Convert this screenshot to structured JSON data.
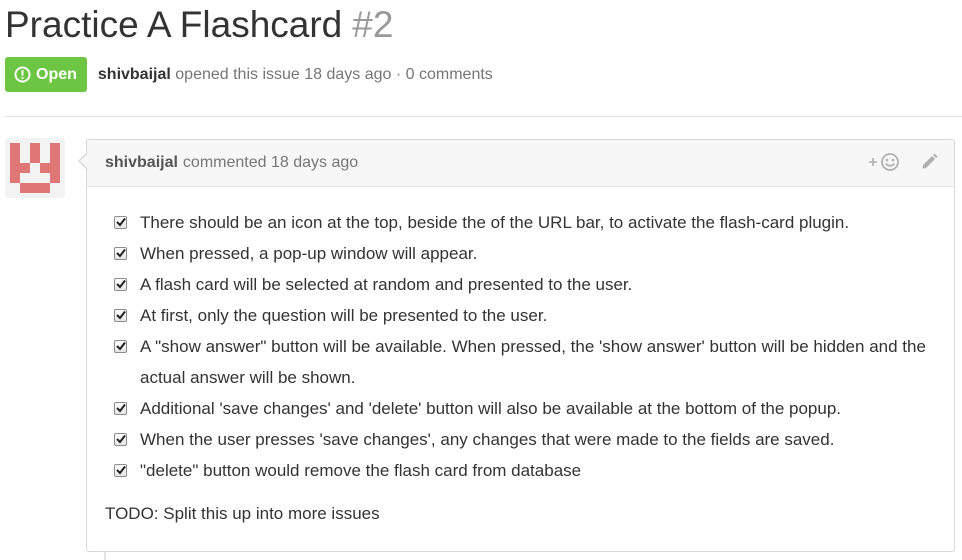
{
  "issue": {
    "title": "Practice A Flashcard",
    "number": "#2",
    "state_label": "Open",
    "author": "shivbaijal",
    "opened_text": "opened this issue 18 days ago · 0 comments"
  },
  "comment": {
    "author": "shivbaijal",
    "header_text": "commented 18 days ago",
    "reaction_icon": "smiley-add-icon",
    "edit_icon": "pencil-icon",
    "tasks": [
      {
        "text": "There should be an icon at the top, beside the of the URL bar, to activate the flash-card plugin.",
        "checked": true
      },
      {
        "text": "When pressed, a pop-up window will appear.",
        "checked": true
      },
      {
        "text": "A flash card will be selected at random and presented to the user.",
        "checked": true
      },
      {
        "text": "At first, only the question will be presented to the user.",
        "checked": true
      },
      {
        "text": "A \"show answer\" button will be available. When pressed, the 'show answer' button will be hidden and the actual answer will be shown.",
        "checked": true
      },
      {
        "text": "Additional 'save changes' and 'delete' button will also be available at the bottom of the popup.",
        "checked": true
      },
      {
        "text": "When the user presses 'save changes', any changes that were made to the fields are saved.",
        "checked": true
      },
      {
        "text": "\"delete\" button would remove the flash card from database",
        "checked": true
      }
    ],
    "footer_text": "TODO: Split this up into more issues"
  },
  "colors": {
    "open_badge": "#6cc644",
    "avatar": "#e07777",
    "muted_text": "#767676"
  }
}
